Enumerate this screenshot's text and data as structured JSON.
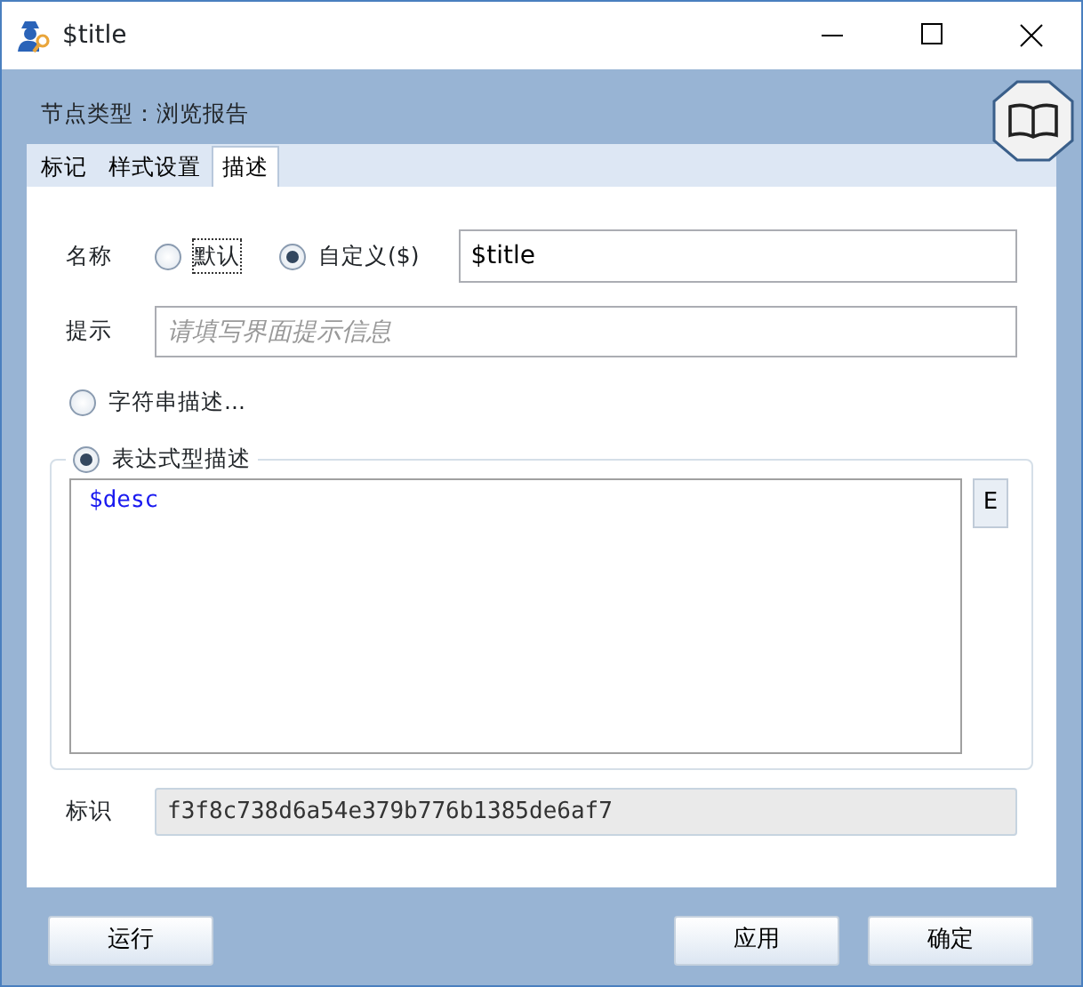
{
  "window": {
    "title": "$title"
  },
  "node_type": "节点类型：浏览报告",
  "tabs": [
    {
      "label": "标记",
      "selected": false
    },
    {
      "label": "样式设置",
      "selected": false
    },
    {
      "label": "描述",
      "selected": true
    }
  ],
  "name": {
    "label": "名称",
    "options": [
      {
        "label": "默认",
        "selected": false,
        "focused": true
      },
      {
        "label": "自定义($)",
        "selected": true,
        "focused": false
      }
    ],
    "value": "$title"
  },
  "hint": {
    "label": "提示",
    "placeholder": "请填写界面提示信息"
  },
  "description_modes": [
    {
      "label": "字符串描述...",
      "selected": false
    },
    {
      "label": "表达式型描述",
      "selected": true
    }
  ],
  "expression": {
    "value": "$desc",
    "button": "E"
  },
  "identifier": {
    "label": "标识",
    "value": "f3f8c738d6a54e379b776b1385de6af7"
  },
  "buttons_left": [
    "运行"
  ],
  "buttons_right": [
    "应用",
    "确定"
  ]
}
